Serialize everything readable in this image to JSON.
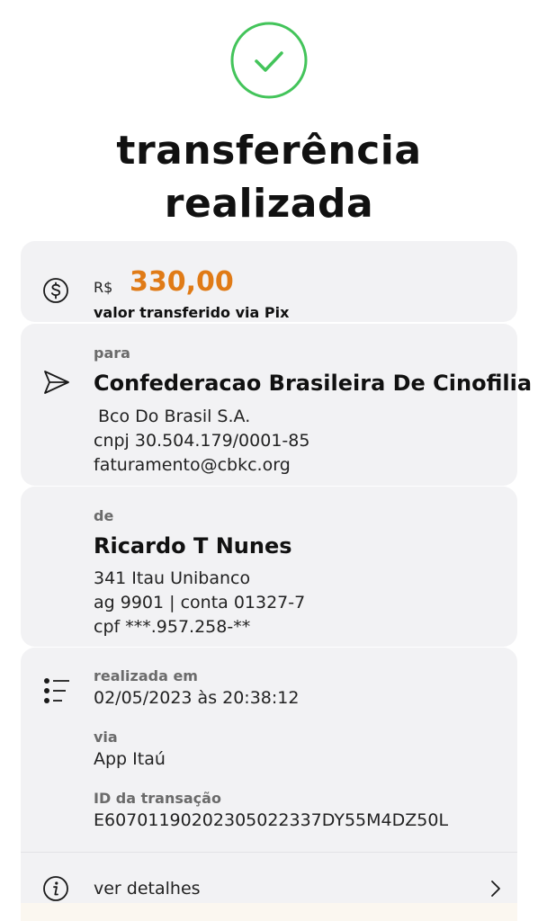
{
  "header": {
    "title_line1": "transferência",
    "title_line2": "realizada",
    "success_color": "#43c45a"
  },
  "amount": {
    "currency": "R$",
    "value": "330,00",
    "caption": "valor transferido via Pix",
    "value_color": "#e07b17",
    "icon": "dollar-circle-icon"
  },
  "recipient": {
    "label": "para",
    "name": "Confederacao Brasileira De Cinofilia",
    "bank": "Bco Do Brasil S.A.",
    "document": "cnpj 30.504.179/0001-85",
    "email": "faturamento@cbkc.org",
    "icon": "send-icon"
  },
  "sender": {
    "label": "de",
    "name": "Ricardo T Nunes",
    "bank": "341 Itau Unibanco",
    "account": "ag 9901 | conta 01327-7",
    "document": "cpf ***.957.258-**"
  },
  "transaction": {
    "icon": "list-icon",
    "date_label": "realizada em",
    "date_value": "02/05/2023 às 20:38:12",
    "channel_label": "via",
    "channel_value": "App Itaú",
    "id_label": "ID da transação",
    "id_value": "E60701190202305022337DY55M4DZ50L"
  },
  "details": {
    "label": "ver detalhes",
    "icon": "info-icon",
    "chevron": "chevron-right-icon"
  }
}
